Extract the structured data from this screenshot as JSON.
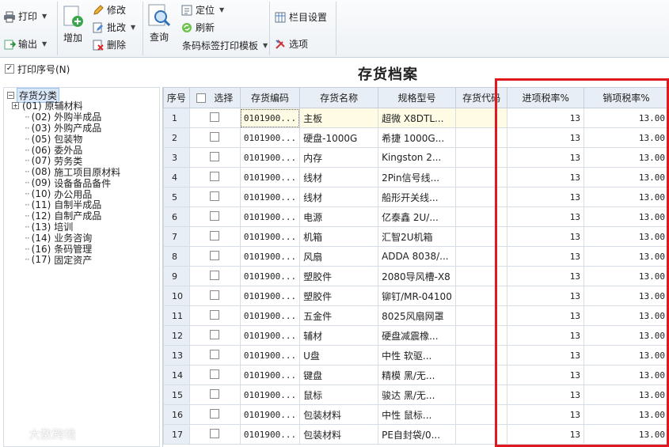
{
  "toolbar": {
    "print": "打印",
    "export": "输出",
    "add": "增加",
    "modify": "修改",
    "batch_modify": "批改",
    "delete": "删除",
    "query": "查询",
    "locate": "定位",
    "refresh": "刷新",
    "barcode_template": "条码标签打印模板",
    "column_settings": "栏目设置",
    "options": "选项"
  },
  "print_seq_label": "打印序号(N)",
  "title": "存货档案",
  "tree": {
    "root": "存货分类",
    "items": [
      {
        "code": "(01)",
        "name": "原辅材料",
        "expandable": true
      },
      {
        "code": "(02)",
        "name": "外购半成品",
        "expandable": false
      },
      {
        "code": "(03)",
        "name": "外购产成品",
        "expandable": false
      },
      {
        "code": "(05)",
        "name": "包装物",
        "expandable": false
      },
      {
        "code": "(06)",
        "name": "委外品",
        "expandable": false
      },
      {
        "code": "(07)",
        "name": "劳务类",
        "expandable": false
      },
      {
        "code": "(08)",
        "name": "施工项目原材料",
        "expandable": false
      },
      {
        "code": "(09)",
        "name": "设备备品备件",
        "expandable": false
      },
      {
        "code": "(10)",
        "name": "办公用品",
        "expandable": false
      },
      {
        "code": "(11)",
        "name": "自制半成品",
        "expandable": false
      },
      {
        "code": "(12)",
        "name": "自制产成品",
        "expandable": false
      },
      {
        "code": "(13)",
        "name": "培训",
        "expandable": false
      },
      {
        "code": "(14)",
        "name": "业务咨询",
        "expandable": false
      },
      {
        "code": "(16)",
        "name": "条码管理",
        "expandable": false
      },
      {
        "code": "(17)",
        "name": "固定资产",
        "expandable": false
      }
    ]
  },
  "columns": {
    "seq": "序号",
    "select": "选择",
    "code": "存货编码",
    "name": "存货名称",
    "spec": "规格型号",
    "inv_code": "存货代码",
    "in_tax": "进项税率%",
    "out_tax": "销项税率%"
  },
  "rows": [
    {
      "seq": "1",
      "code": "0101900...",
      "name": "主板",
      "spec": "超微 X8DTL...",
      "inv_code": "",
      "in_tax": "13",
      "out_tax": "13.00"
    },
    {
      "seq": "2",
      "code": "0101900...",
      "name": "硬盘-1000G",
      "spec": "希捷 1000G...",
      "inv_code": "",
      "in_tax": "13",
      "out_tax": "13.00"
    },
    {
      "seq": "3",
      "code": "0101900...",
      "name": "内存",
      "spec": "Kingston 2...",
      "inv_code": "",
      "in_tax": "13",
      "out_tax": "13.00"
    },
    {
      "seq": "4",
      "code": "0101900...",
      "name": "线材",
      "spec": "2Pin信号线...",
      "inv_code": "",
      "in_tax": "13",
      "out_tax": "13.00"
    },
    {
      "seq": "5",
      "code": "0101900...",
      "name": "线材",
      "spec": "船形开关线...",
      "inv_code": "",
      "in_tax": "13",
      "out_tax": "13.00"
    },
    {
      "seq": "6",
      "code": "0101900...",
      "name": "电源",
      "spec": "亿泰鑫 2U/...",
      "inv_code": "",
      "in_tax": "13",
      "out_tax": "13.00"
    },
    {
      "seq": "7",
      "code": "0101900...",
      "name": "机箱",
      "spec": "汇智2U机箱",
      "inv_code": "",
      "in_tax": "13",
      "out_tax": "13.00"
    },
    {
      "seq": "8",
      "code": "0101900...",
      "name": "风扇",
      "spec": "ADDA 8038/...",
      "inv_code": "",
      "in_tax": "13",
      "out_tax": "13.00"
    },
    {
      "seq": "9",
      "code": "0101900...",
      "name": "塑胶件",
      "spec": "2080导风槽-X8",
      "inv_code": "",
      "in_tax": "13",
      "out_tax": "13.00"
    },
    {
      "seq": "10",
      "code": "0101900...",
      "name": "塑胶件",
      "spec": "铆钉/MR-04100",
      "inv_code": "",
      "in_tax": "13",
      "out_tax": "13.00"
    },
    {
      "seq": "11",
      "code": "0101900...",
      "name": "五金件",
      "spec": "8025风扇网罩",
      "inv_code": "",
      "in_tax": "13",
      "out_tax": "13.00"
    },
    {
      "seq": "12",
      "code": "0101900...",
      "name": "辅材",
      "spec": "硬盘减震橡...",
      "inv_code": "",
      "in_tax": "13",
      "out_tax": "13.00"
    },
    {
      "seq": "13",
      "code": "0101900...",
      "name": "U盘",
      "spec": "中性 软驱...",
      "inv_code": "",
      "in_tax": "13",
      "out_tax": "13.00"
    },
    {
      "seq": "14",
      "code": "0101900...",
      "name": "键盘",
      "spec": "精模 黑/无...",
      "inv_code": "",
      "in_tax": "13",
      "out_tax": "13.00"
    },
    {
      "seq": "15",
      "code": "0101900...",
      "name": "鼠标",
      "spec": "骏达 黑/无...",
      "inv_code": "",
      "in_tax": "13",
      "out_tax": "13.00"
    },
    {
      "seq": "16",
      "code": "0101900...",
      "name": "包装材料",
      "spec": "中性 鼠标...",
      "inv_code": "",
      "in_tax": "13",
      "out_tax": "13.00"
    },
    {
      "seq": "17",
      "code": "0101900...",
      "name": "包装材料",
      "spec": "PE自封袋/0...",
      "inv_code": "",
      "in_tax": "13",
      "out_tax": "13.00"
    }
  ],
  "watermark": "大数跨境",
  "colors": {
    "highlight_border": "#e0181f",
    "header_bg": "#e8eef5",
    "selected_row": "#fffbe4"
  }
}
